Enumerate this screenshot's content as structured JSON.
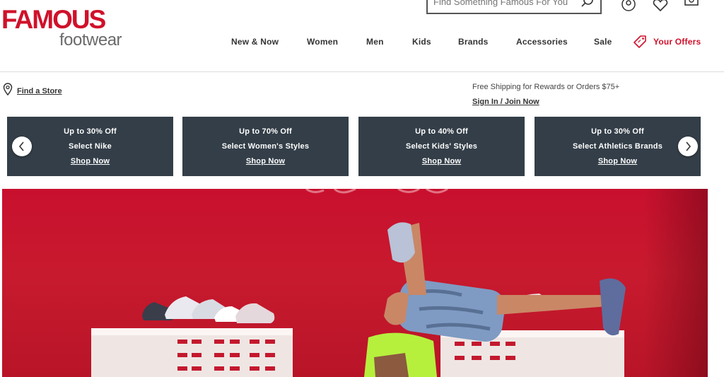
{
  "brand": {
    "name_top": "FAMOUS",
    "name_bottom": "footwear"
  },
  "search": {
    "placeholder": "Find Something Famous For You"
  },
  "nav": {
    "items": [
      {
        "label": "New & Now"
      },
      {
        "label": "Women"
      },
      {
        "label": "Men"
      },
      {
        "label": "Kids"
      },
      {
        "label": "Brands"
      },
      {
        "label": "Accessories"
      },
      {
        "label": "Sale"
      },
      {
        "label": "Your Offers"
      }
    ]
  },
  "subbar": {
    "find_store": "Find a Store",
    "shipping": "Free Shipping for Rewards or Orders $75+",
    "signin": "Sign In / Join Now"
  },
  "promos": [
    {
      "line1": "Up to 30% Off",
      "line2": "Select Nike",
      "cta": "Shop Now"
    },
    {
      "line1": "Up to 70% Off",
      "line2": "Select Women's Styles",
      "cta": "Shop Now"
    },
    {
      "line1": "Up to 40% Off",
      "line2": "Select Kids' Styles",
      "cta": "Shop Now"
    },
    {
      "line1": "Up to 30% Off",
      "line2": "Select Athletics Brands",
      "cta": "Shop Now"
    }
  ],
  "colors": {
    "brand_red": "#d0112b",
    "promo_bg": "#333e48",
    "hero_red": "#c8102e"
  },
  "icons": [
    "search-icon",
    "account-icon",
    "heart-icon",
    "bag-icon",
    "tag-icon",
    "location-pin-icon",
    "chevron-left-icon",
    "chevron-right-icon"
  ]
}
